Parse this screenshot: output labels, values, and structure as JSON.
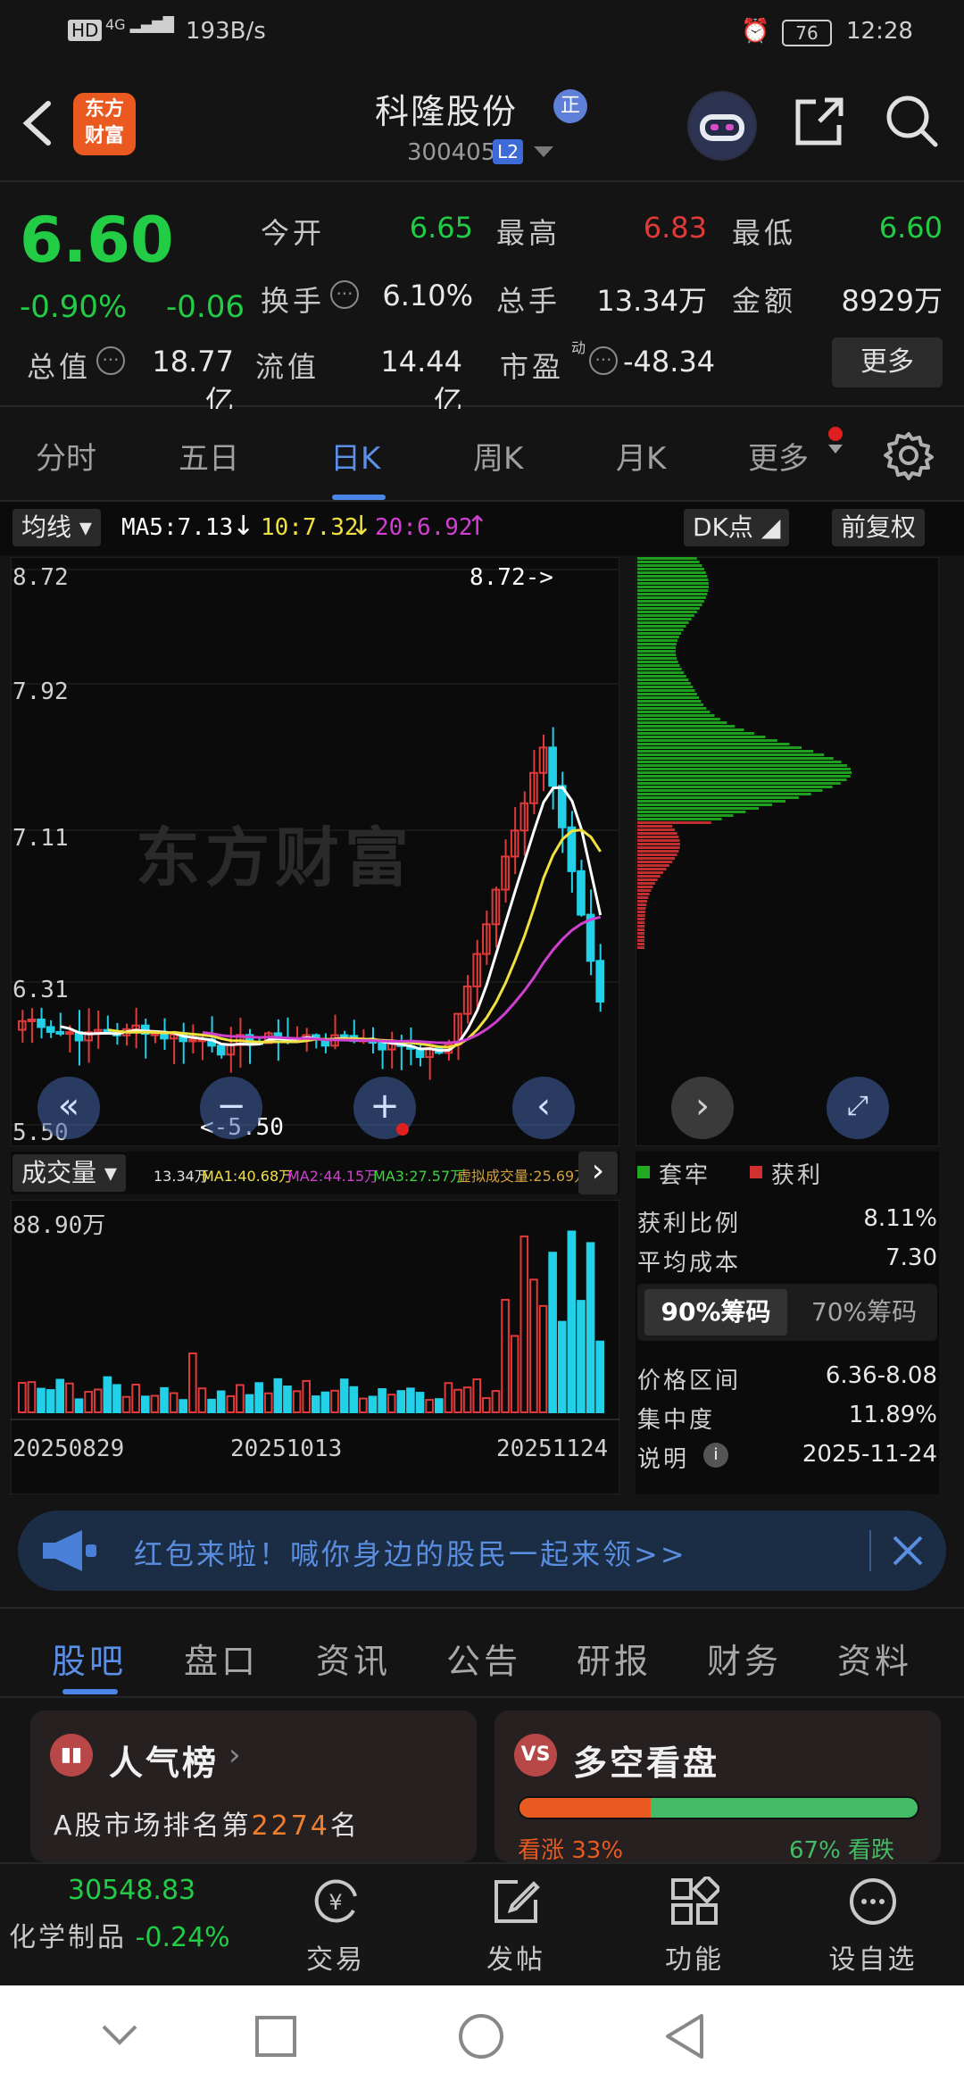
{
  "status_bar": {
    "net_speed": "193B/s",
    "battery": "76",
    "time": "12:28"
  },
  "header": {
    "logo_text_1": "东方",
    "logo_text_2": "财富",
    "stock_name": "科隆股份",
    "badge": "正",
    "stock_code": "300405",
    "level_badge": "L2"
  },
  "quote": {
    "price": "6.60",
    "change_pct": "-0.90%",
    "change_abs": "-0.06",
    "open_label": "今开",
    "open_value": "6.65",
    "high_label": "最高",
    "high_value": "6.83",
    "low_label": "最低",
    "low_value": "6.60",
    "turnover_label": "换手",
    "turnover_value": "6.10%",
    "volume_label": "总手",
    "volume_value": "13.34万",
    "amount_label": "金额",
    "amount_value": "8929万",
    "mktcap_label": "总值",
    "mktcap_value": "18.77亿",
    "float_label": "流值",
    "float_value": "14.44亿",
    "pe_label": "市盈",
    "pe_sup": "动",
    "pe_value": "-48.34",
    "more_button": "更多"
  },
  "period_tabs": [
    "分时",
    "五日",
    "日K",
    "周K",
    "月K",
    "更多"
  ],
  "indicator": {
    "ma_chip": "均线",
    "ma5": "MA5:7.13",
    "ma10": "10:7.32",
    "ma20": "20:6.92",
    "dk_chip": "DK点",
    "adjust_chip": "前复权"
  },
  "chart": {
    "y_labels": [
      "8.72",
      "7.92",
      "7.11",
      "6.31",
      "5.50"
    ],
    "max_marker": "8.72->",
    "min_marker": "<-5.50",
    "watermark": "东方财富"
  },
  "volume": {
    "chip": "成交量",
    "vol": "13.34万",
    "ma1": "MA1:40.68万",
    "ma2": "MA2:44.15万",
    "ma3": "MA3:27.57万",
    "virtual": "虚拟成交量:25.69万",
    "max_label": "88.90万",
    "dates": [
      "20250829",
      "20251013",
      "20251124"
    ]
  },
  "chip_stats": {
    "legend_lock": "套牢",
    "legend_profit": "获利",
    "profit_ratio_label": "获利比例",
    "profit_ratio_value": "8.11%",
    "avg_cost_label": "平均成本",
    "avg_cost_value": "7.30",
    "tab_90": "90%筹码",
    "tab_70": "70%筹码",
    "range_label": "价格区间",
    "range_value": "6.36-8.08",
    "conc_label": "集中度",
    "conc_value": "11.89%",
    "note_label": "说明",
    "note_value": "2025-11-24"
  },
  "banner": {
    "text": "红包来啦！喊你身边的股民一起来领>>"
  },
  "bottom_tabs": [
    "股吧",
    "盘口",
    "资讯",
    "公告",
    "研报",
    "财务",
    "资料"
  ],
  "cards": {
    "popularity_title": "人气榜",
    "popularity_line_prefix": "A股市场排名第",
    "popularity_rank": "2274",
    "popularity_line_suffix": "名",
    "duokong_title": "多空看盘",
    "duokong_icon": "VS",
    "bull_label": "看涨 33%",
    "bear_label": "67% 看跌",
    "bull_ratio": 0.33
  },
  "toolbar": {
    "index_value": "30548.83",
    "index_name": "化学制品",
    "index_change": "-0.24%",
    "trade": "交易",
    "post": "发帖",
    "functions": "功能",
    "watchlist": "设自选"
  },
  "colors": {
    "up": "#e03a3a",
    "down": "#22cc44",
    "accent": "#4a86e8",
    "ma5": "#ffffff",
    "ma10": "#f0e040",
    "ma20": "#d040d0"
  }
}
